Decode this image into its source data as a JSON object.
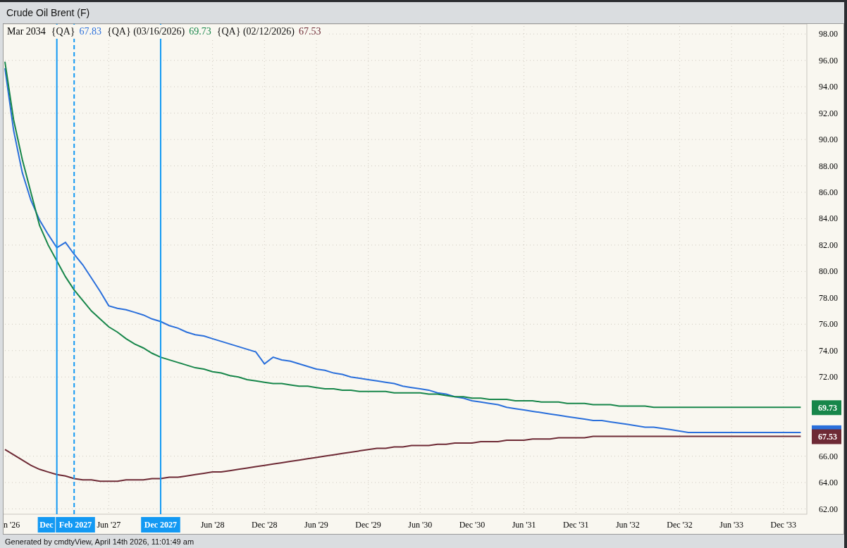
{
  "window": {
    "title": "Crude Oil Brent (F)"
  },
  "legend": {
    "contract": "Mar 2034",
    "items": [
      {
        "label": "{QA}",
        "value": "67.83"
      },
      {
        "label": "{QA} (03/16/2026)",
        "value": "69.73"
      },
      {
        "label": "{QA} (02/12/2026)",
        "value": "67.53"
      }
    ]
  },
  "axis_edge_label": "n '26",
  "chart_data": {
    "type": "line",
    "grid": true,
    "categories": [
      null,
      null,
      null,
      null,
      null,
      null,
      null,
      null,
      null,
      null,
      null,
      null,
      "Jun '27",
      null,
      null,
      null,
      null,
      null,
      null,
      null,
      null,
      null,
      null,
      null,
      "Jun '28",
      null,
      null,
      null,
      null,
      null,
      "Dec '28",
      null,
      null,
      null,
      null,
      null,
      "Jun '29",
      null,
      null,
      null,
      null,
      null,
      "Dec '29",
      null,
      null,
      null,
      null,
      null,
      "Jun '30",
      null,
      null,
      null,
      null,
      null,
      "Dec '30",
      null,
      null,
      null,
      null,
      null,
      "Jun '31",
      null,
      null,
      null,
      null,
      null,
      "Dec '31",
      null,
      null,
      null,
      null,
      null,
      "Jun '32",
      null,
      null,
      null,
      null,
      null,
      "Dec '32",
      null,
      null,
      null,
      null,
      null,
      "Jun '33",
      null,
      null,
      null,
      null,
      null,
      "Dec '33",
      null,
      null
    ],
    "series": [
      {
        "color": "#2a6fdb",
        "values": [
          95.4,
          90.7,
          87.5,
          85.4,
          83.9,
          82.8,
          81.8,
          82.2,
          81.3,
          80.5,
          79.5,
          78.5,
          77.4,
          77.2,
          77.1,
          76.9,
          76.7,
          76.4,
          76.2,
          75.9,
          75.7,
          75.4,
          75.2,
          75.1,
          74.9,
          74.7,
          74.5,
          74.3,
          74.1,
          73.9,
          73.0,
          73.5,
          73.3,
          73.2,
          73.0,
          72.8,
          72.6,
          72.5,
          72.3,
          72.2,
          72.0,
          71.9,
          71.8,
          71.7,
          71.6,
          71.5,
          71.3,
          71.2,
          71.1,
          71.0,
          70.8,
          70.7,
          70.5,
          70.4,
          70.2,
          70.1,
          70.0,
          69.9,
          69.7,
          69.6,
          69.5,
          69.4,
          69.3,
          69.2,
          69.1,
          69.0,
          68.9,
          68.8,
          68.7,
          68.7,
          68.6,
          68.5,
          68.4,
          68.3,
          68.2,
          68.2,
          68.1,
          68.0,
          67.9,
          67.8,
          67.8,
          67.8,
          67.8,
          67.8,
          67.8,
          67.8,
          67.8,
          67.8,
          67.8,
          67.8,
          67.8,
          67.8,
          67.8
        ]
      },
      {
        "color": "#17864a",
        "values": [
          95.9,
          91.5,
          88.5,
          86.0,
          83.5,
          82.0,
          80.8,
          79.6,
          78.6,
          77.8,
          77.0,
          76.4,
          75.8,
          75.4,
          74.9,
          74.5,
          74.2,
          73.8,
          73.5,
          73.3,
          73.1,
          72.9,
          72.7,
          72.6,
          72.4,
          72.3,
          72.1,
          72.0,
          71.8,
          71.7,
          71.6,
          71.5,
          71.5,
          71.4,
          71.3,
          71.3,
          71.2,
          71.1,
          71.1,
          71.0,
          71.0,
          70.9,
          70.9,
          70.9,
          70.9,
          70.8,
          70.8,
          70.8,
          70.8,
          70.7,
          70.7,
          70.6,
          70.5,
          70.5,
          70.4,
          70.4,
          70.3,
          70.3,
          70.3,
          70.2,
          70.2,
          70.2,
          70.1,
          70.1,
          70.1,
          70.0,
          70.0,
          70.0,
          69.9,
          69.9,
          69.9,
          69.8,
          69.8,
          69.8,
          69.8,
          69.7,
          69.7,
          69.7,
          69.7,
          69.7,
          69.7,
          69.7,
          69.7,
          69.7,
          69.7,
          69.7,
          69.7,
          69.7,
          69.7,
          69.7,
          69.7,
          69.7,
          69.7
        ]
      },
      {
        "color": "#6e2a35",
        "values": [
          66.5,
          66.1,
          65.7,
          65.3,
          65.0,
          64.8,
          64.6,
          64.5,
          64.3,
          64.2,
          64.2,
          64.1,
          64.1,
          64.1,
          64.2,
          64.2,
          64.2,
          64.3,
          64.3,
          64.4,
          64.4,
          64.5,
          64.6,
          64.7,
          64.8,
          64.8,
          64.9,
          65.0,
          65.1,
          65.2,
          65.3,
          65.4,
          65.5,
          65.6,
          65.7,
          65.8,
          65.9,
          66.0,
          66.1,
          66.2,
          66.3,
          66.4,
          66.5,
          66.6,
          66.6,
          66.7,
          66.7,
          66.8,
          66.8,
          66.8,
          66.9,
          66.9,
          67.0,
          67.0,
          67.0,
          67.1,
          67.1,
          67.1,
          67.2,
          67.2,
          67.2,
          67.3,
          67.3,
          67.3,
          67.4,
          67.4,
          67.4,
          67.4,
          67.5,
          67.5,
          67.5,
          67.5,
          67.5,
          67.5,
          67.5,
          67.5,
          67.5,
          67.5,
          67.5,
          67.5,
          67.5,
          67.5,
          67.5,
          67.5,
          67.5,
          67.5,
          67.5,
          67.5,
          67.5,
          67.5,
          67.5,
          67.5,
          67.5
        ]
      }
    ],
    "ylim": [
      61.6,
      98.6
    ],
    "yticks": [
      {
        "value": 62,
        "label": "62.00"
      },
      {
        "value": 64,
        "label": "64.00"
      },
      {
        "value": 66,
        "label": "66.00"
      },
      {
        "value": 72,
        "label": "72.00"
      },
      {
        "value": 74,
        "label": "74.00"
      },
      {
        "value": 76,
        "label": "76.00"
      },
      {
        "value": 78,
        "label": "78.00"
      },
      {
        "value": 80,
        "label": "80.00"
      },
      {
        "value": 82,
        "label": "82.00"
      },
      {
        "value": 84,
        "label": "84.00"
      },
      {
        "value": 86,
        "label": "86.00"
      },
      {
        "value": 88,
        "label": "88.00"
      },
      {
        "value": 90,
        "label": "90.00"
      },
      {
        "value": 92,
        "label": "92.00"
      },
      {
        "value": 94,
        "label": "94.00"
      },
      {
        "value": 96,
        "label": "96.00"
      },
      {
        "value": 98,
        "label": "98.00"
      }
    ],
    "annotations": [
      "Dec",
      "Feb 2027",
      "Dec 2027"
    ]
  },
  "axis_badges": [
    {
      "kind": "partial"
    },
    {
      "kind": "full",
      "label": "69.73"
    },
    {
      "kind": "full",
      "label": "67.53"
    }
  ],
  "status_bar": {
    "text": "Generated by cmdtyView, April 14th 2026, 11:01:49 am"
  }
}
